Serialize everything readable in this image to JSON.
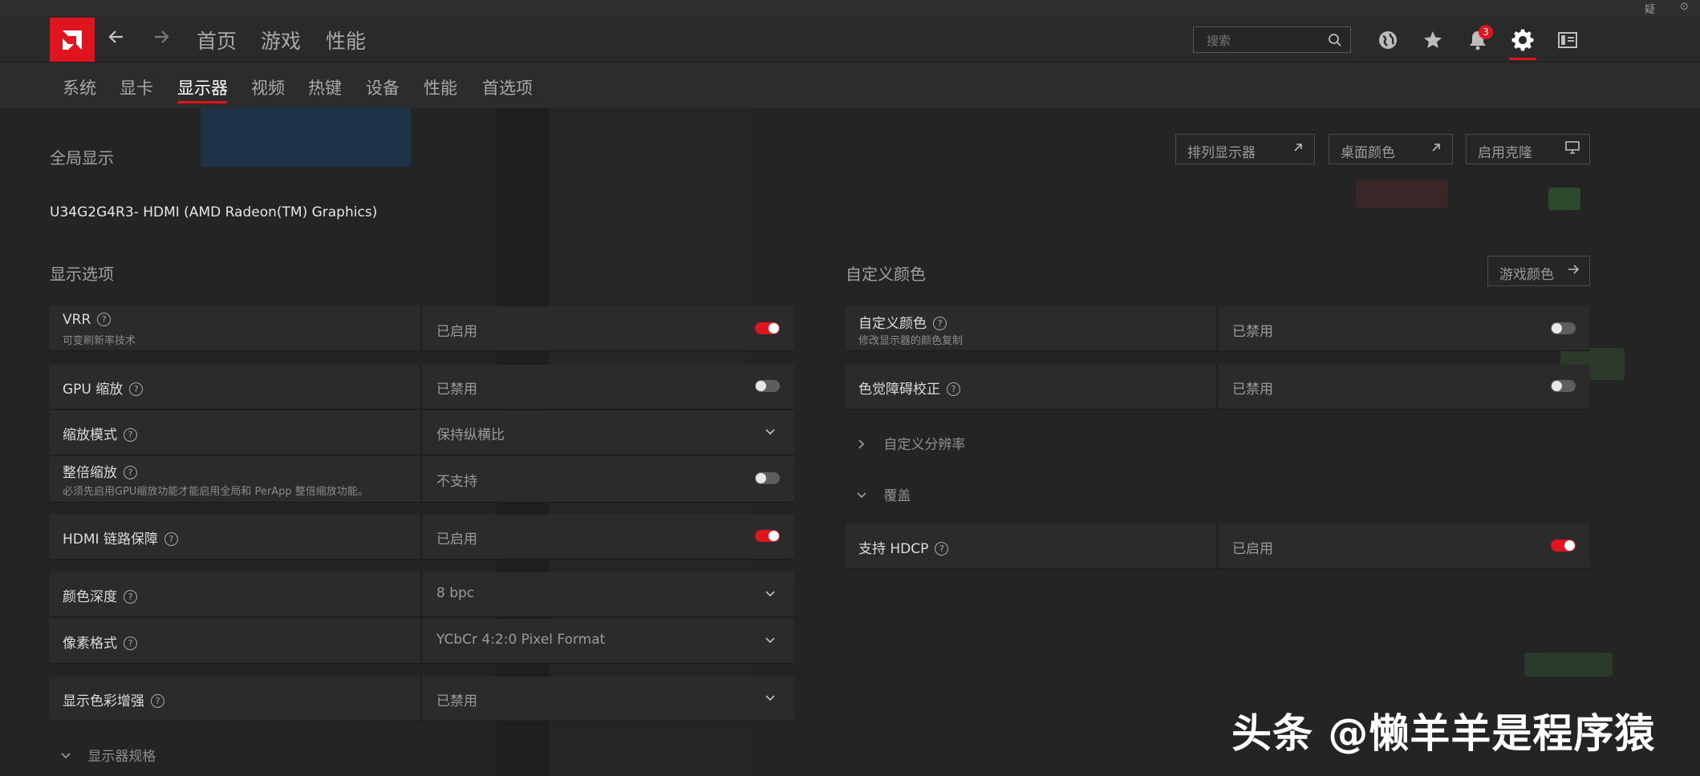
{
  "titlebar": {
    "btn_a": "疑",
    "btn_b": "⊙"
  },
  "header": {
    "nav": [
      "首页",
      "游戏",
      "性能"
    ],
    "search_placeholder": "搜索",
    "notification_count": "3",
    "accent": "#e0141e"
  },
  "subnav": [
    "系统",
    "显卡",
    "显示器",
    "视频",
    "热键",
    "设备",
    "性能",
    "首选项"
  ],
  "page": {
    "section_title": "全局显示",
    "monitor": "U34G2G4R3- HDMI (AMD Radeon(TM) Graphics)",
    "top_buttons": [
      "排列显示器",
      "桌面颜色",
      "启用克隆"
    ]
  },
  "left": {
    "title": "显示选项",
    "rows": [
      {
        "label": "VRR",
        "sub": "可变刷新率技术",
        "value": "已启用",
        "control": "toggle-on"
      },
      {
        "label": "GPU 缩放",
        "value": "已禁用",
        "control": "toggle-off"
      },
      {
        "label": "缩放模式",
        "value": "保持纵横比",
        "control": "dropdown"
      },
      {
        "label": "整倍缩放",
        "sub": "必须先启用GPU缩放功能才能启用全局和 PerApp 整倍缩放功能。",
        "value": "不支持",
        "control": "toggle-off"
      },
      {
        "label": "HDMI 链路保障",
        "value": "已启用",
        "control": "toggle-on"
      },
      {
        "label": "颜色深度",
        "value": "8 bpc",
        "control": "dropdown"
      },
      {
        "label": "像素格式",
        "value": "YCbCr 4:2:0 Pixel Format",
        "control": "dropdown"
      },
      {
        "label": "显示色彩增强",
        "value": "已禁用",
        "control": "dropdown"
      }
    ],
    "fold": "显示器规格"
  },
  "right": {
    "title": "自定义颜色",
    "button": "游戏颜色",
    "rows": [
      {
        "label": "自定义颜色",
        "sub": "修改显示器的颜色复制",
        "value": "已禁用",
        "control": "toggle-off"
      },
      {
        "label": "色觉障碍校正",
        "value": "已禁用",
        "control": "toggle-off"
      }
    ],
    "fold_resolution": "自定义分辨率",
    "fold_overlay": "覆盖",
    "hdcp": {
      "label": "支持 HDCP",
      "value": "已启用",
      "control": "toggle-on"
    }
  },
  "watermark": "头条 @懒羊羊是程序猿"
}
